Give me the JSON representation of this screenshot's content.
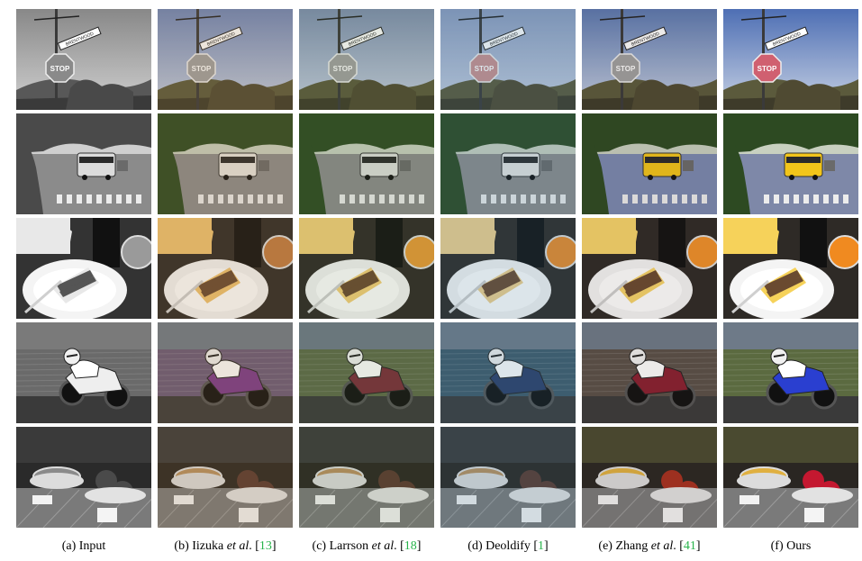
{
  "captions": [
    {
      "label": "(a) Input",
      "method": "",
      "etal": "",
      "dot": "",
      "lb": "",
      "cite": "",
      "rb": ""
    },
    {
      "label": "(b) Iizuka ",
      "method": "",
      "etal": "et al",
      "dot": ".",
      "lb": " [",
      "cite": "13",
      "rb": "]"
    },
    {
      "label": "(c) Larrson ",
      "method": "",
      "etal": "et al",
      "dot": ".",
      "lb": " [",
      "cite": "18",
      "rb": "]"
    },
    {
      "label": "(d) Deoldify",
      "method": "",
      "etal": "",
      "dot": "",
      "lb": " [",
      "cite": "1",
      "rb": "]"
    },
    {
      "label": "(e) Zhang ",
      "method": "",
      "etal": "et al",
      "dot": ".",
      "lb": " [",
      "cite": "41",
      "rb": "]"
    },
    {
      "label": "(f) Ours",
      "method": "",
      "etal": "",
      "dot": "",
      "lb": "",
      "cite": "",
      "rb": ""
    }
  ],
  "sign_text": {
    "stop": "STOP",
    "street": "BRENTWOOD"
  },
  "rows": [
    "stop-sign",
    "bus",
    "cake",
    "motorcycle",
    "kitchen"
  ],
  "colors": {
    "citation": "#27b34a",
    "sky": "#5b78a8",
    "bus_yellow": "#f2c51a",
    "bike_blue": "#2a3fd0",
    "orange": "#f08a20"
  }
}
